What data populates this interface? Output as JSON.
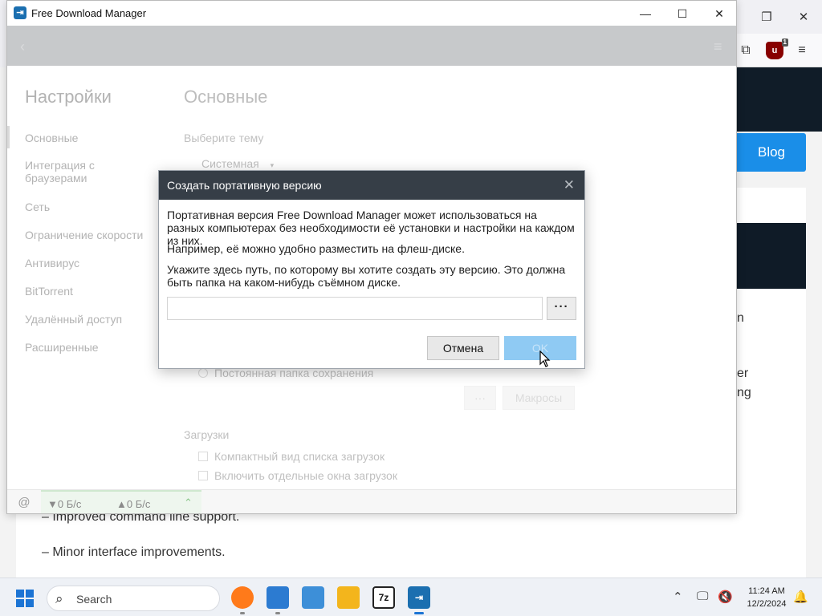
{
  "browser": {
    "blog_button": "Blog",
    "article_lines": [
      "– Improved command line support.",
      "– Minor interface improvements."
    ],
    "clipped_letters": [
      "n",
      "er",
      "ng"
    ],
    "ublock_count": "1"
  },
  "fdm": {
    "window_title": "Free Download Manager",
    "settings_title": "Настройки",
    "section_title": "Основные",
    "nav": [
      "Основные",
      "Интеграция с браузерами",
      "Сеть",
      "Ограничение скорости",
      "Антивирус",
      "BitTorrent",
      "Удалённый доступ",
      "Расширенные"
    ],
    "theme_label": "Выберите тему",
    "theme_value": "Системная",
    "save_folder_option": "Постоянная папка сохранения",
    "browse_dots": "···",
    "macros_button": "Макросы",
    "downloads_section": "Загрузки",
    "compact_view": "Компактный вид списка загрузок",
    "separate_windows": "Включить отдельные окна загрузок",
    "status": {
      "download_speed": "▼0 Б/с",
      "upload_speed": "▲0 Б/с"
    }
  },
  "dialog": {
    "title": "Создать портативную версию",
    "paragraph1": "Портативная версия Free Download Manager может использоваться на разных компьютерах без необходимости её установки и настройки на каждом из них.",
    "paragraph1b": "Например, её можно удобно разместить на флеш-диске.",
    "paragraph2": "Укажите здесь путь, по которому вы хотите создать эту версию. Это должна быть папка на каком-нибудь съёмном диске.",
    "path_value": "",
    "browse_label": "···",
    "cancel_label": "Отмена",
    "ok_label": "OK"
  },
  "taskbar": {
    "search_placeholder": "Search",
    "apps": [
      "firefox",
      "file-explorer",
      "photos",
      "folder",
      "7z",
      "free-download-manager"
    ],
    "app_7z_label": "7z",
    "time": "11:24 AM",
    "date": "12/2/2024"
  },
  "colors": {
    "dialog_header": "#363e47",
    "ok_button_disabled": "#8fcaf3",
    "blog_button": "#1a8ee8",
    "fdm_topbar": "#aaadb0"
  }
}
